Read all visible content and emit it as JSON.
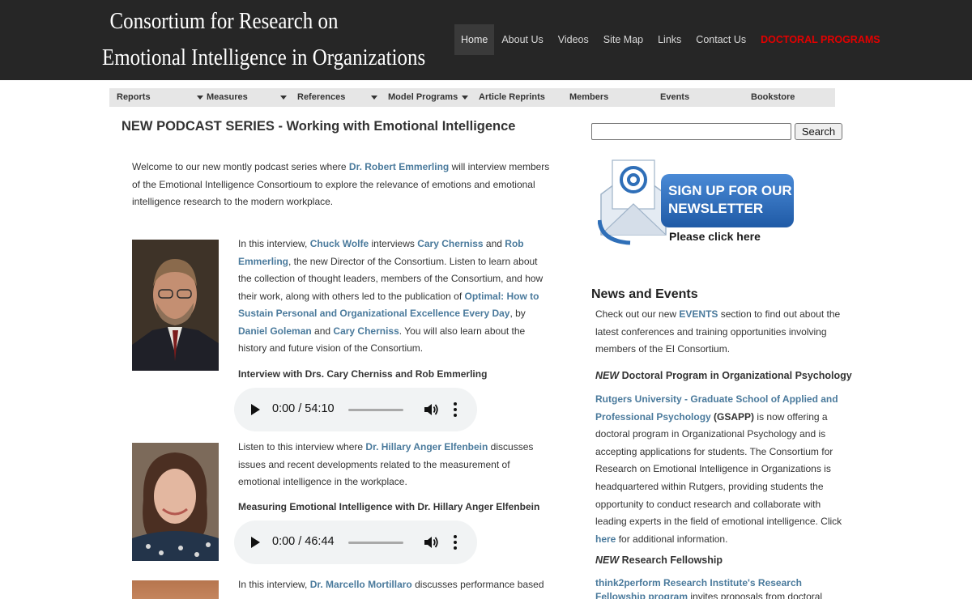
{
  "header": {
    "title_line1": "Consortium for Research on",
    "title_line2": "Emotional Intelligence in Organizations"
  },
  "topnav": {
    "items": [
      "Home",
      "About Us",
      "Videos",
      "Site Map",
      "Links",
      "Contact Us",
      "DOCTORAL PROGRAMS"
    ],
    "active": "Home"
  },
  "subnav": {
    "items": [
      "Reports",
      "Measures",
      "References",
      "Model Programs",
      "Article Reprints",
      "Members",
      "Events",
      "Bookstore"
    ]
  },
  "main": {
    "heading": "NEW PODCAST SERIES - Working with Emotional Intelligence",
    "intro": {
      "t1": "Welcome to our new montly podcast series where ",
      "link1": "Dr. Robert Emmerling",
      "t2": " will interview members of the Emotional Intelligence Consortioum to explore the relevance of emotions and emotional intelligence research to the modern workplace."
    },
    "podcast1": {
      "t1": "In this interview, ",
      "link1": "Chuck Wolfe",
      "t2": " interviews ",
      "link2": "Cary Cherniss",
      "t3": " and ",
      "link3": "Rob Emmerling",
      "t4": ", the new Director of the Consortium. Listen to learn about the collection of thought leaders, members of the Consortium, and how their work, along with others led to the publication of ",
      "link4": "Optimal: How to Sustain Personal and Organizational Excellence Every Day",
      "t5": ", by ",
      "link5": "Daniel Goleman",
      "t6": " and ",
      "link6": "Cary Cherniss",
      "t7": ". You will also learn about the history and future vision of the Consortium.",
      "caption": "Interview with Drs. Cary Cherniss and Rob Emmerling",
      "time": "0:00 / 54:10"
    },
    "podcast2": {
      "t1": "Listen to this interview where ",
      "link1": "Dr. Hillary Anger Elfenbein",
      "t2": " discusses issues and recent developments related to the measurement of emotional intelligence in the workplace.",
      "caption": "Measuring Emotional Intelligence with Dr. Hillary Anger Elfenbein",
      "time": "0:00 / 46:44"
    },
    "podcast3": {
      "t1": "In this interview, ",
      "link1": "Dr. Marcello Mortillaro",
      "t2": " discusses performance based"
    }
  },
  "sidebar": {
    "search_button": "Search",
    "newsletter": {
      "line1": "SIGN UP FOR OUR",
      "line2": "NEWSLETTER",
      "line3": "Please click here"
    },
    "news_heading": "News and Events",
    "news": {
      "t1": "Check out our new ",
      "link1": "EVENTS",
      "t2": " section to find out about the latest conferences and training opportunities involving members of the EI Consortium."
    },
    "doctoral": {
      "new": "NEW",
      "heading": " Doctoral Program in Organizational Psychology",
      "link1": "Rutgers University - Graduate School of Applied and Professional Psychology",
      "t1": " (GSAPP)",
      "t2": " is now offering a doctoral program in Organizational Psychology and is accepting applications for students. The Consortium for Research on Emotional Intelligence in Organizations is headquartered within Rutgers, providing students the opportunity to conduct research and collaborate with leading experts in the field of emotional intelligence. Click ",
      "link2": "here",
      "t3": " for additional information."
    },
    "fellowship": {
      "new": "NEW",
      "heading": " Research Fellowship",
      "link1": "think2perform Research Institute's Research Fellowship program",
      "t1": " invites proposals from doctoral"
    }
  },
  "colors": {
    "header_bg": "#262626",
    "link": "#4a7a9c",
    "doctoral": "#e40000",
    "subnav_bg": "#e6e6e6",
    "newsletter_blue": "#2f6fb8"
  }
}
